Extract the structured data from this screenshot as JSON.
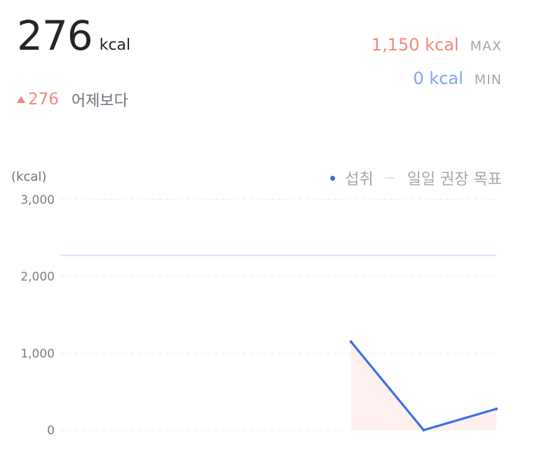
{
  "summary": {
    "total_value": "276",
    "total_unit": "kcal",
    "change_value": "276",
    "change_label": "어제보다"
  },
  "stats": {
    "max_value": "1,150 kcal",
    "max_label": "MAX",
    "min_value": "0 kcal",
    "min_label": "MIN"
  },
  "colors": {
    "intake_line": "#3e6fe0",
    "intake_fill": "#fdf0ef",
    "target_line": "#d6e5fb",
    "positive_change": "#f3887c",
    "max_accent": "#f3887c",
    "min_accent": "#7fa6f6"
  },
  "chart_data": {
    "type": "line",
    "ylabel": "(kcal)",
    "ylim": [
      0,
      3000
    ],
    "y_ticks": [
      3000,
      2000,
      1000,
      0
    ],
    "y_tick_labels": [
      "3,000",
      "2,000",
      "1,000",
      "0"
    ],
    "grid": true,
    "legend_position": "top-right",
    "legend": [
      "섭취",
      "일일 권장 목표"
    ],
    "series": [
      {
        "name": "섭취",
        "values": [
          null,
          null,
          null,
          null,
          1150,
          0,
          276
        ]
      },
      {
        "name": "일일 권장 목표",
        "type": "reference",
        "value": 2275
      }
    ]
  }
}
